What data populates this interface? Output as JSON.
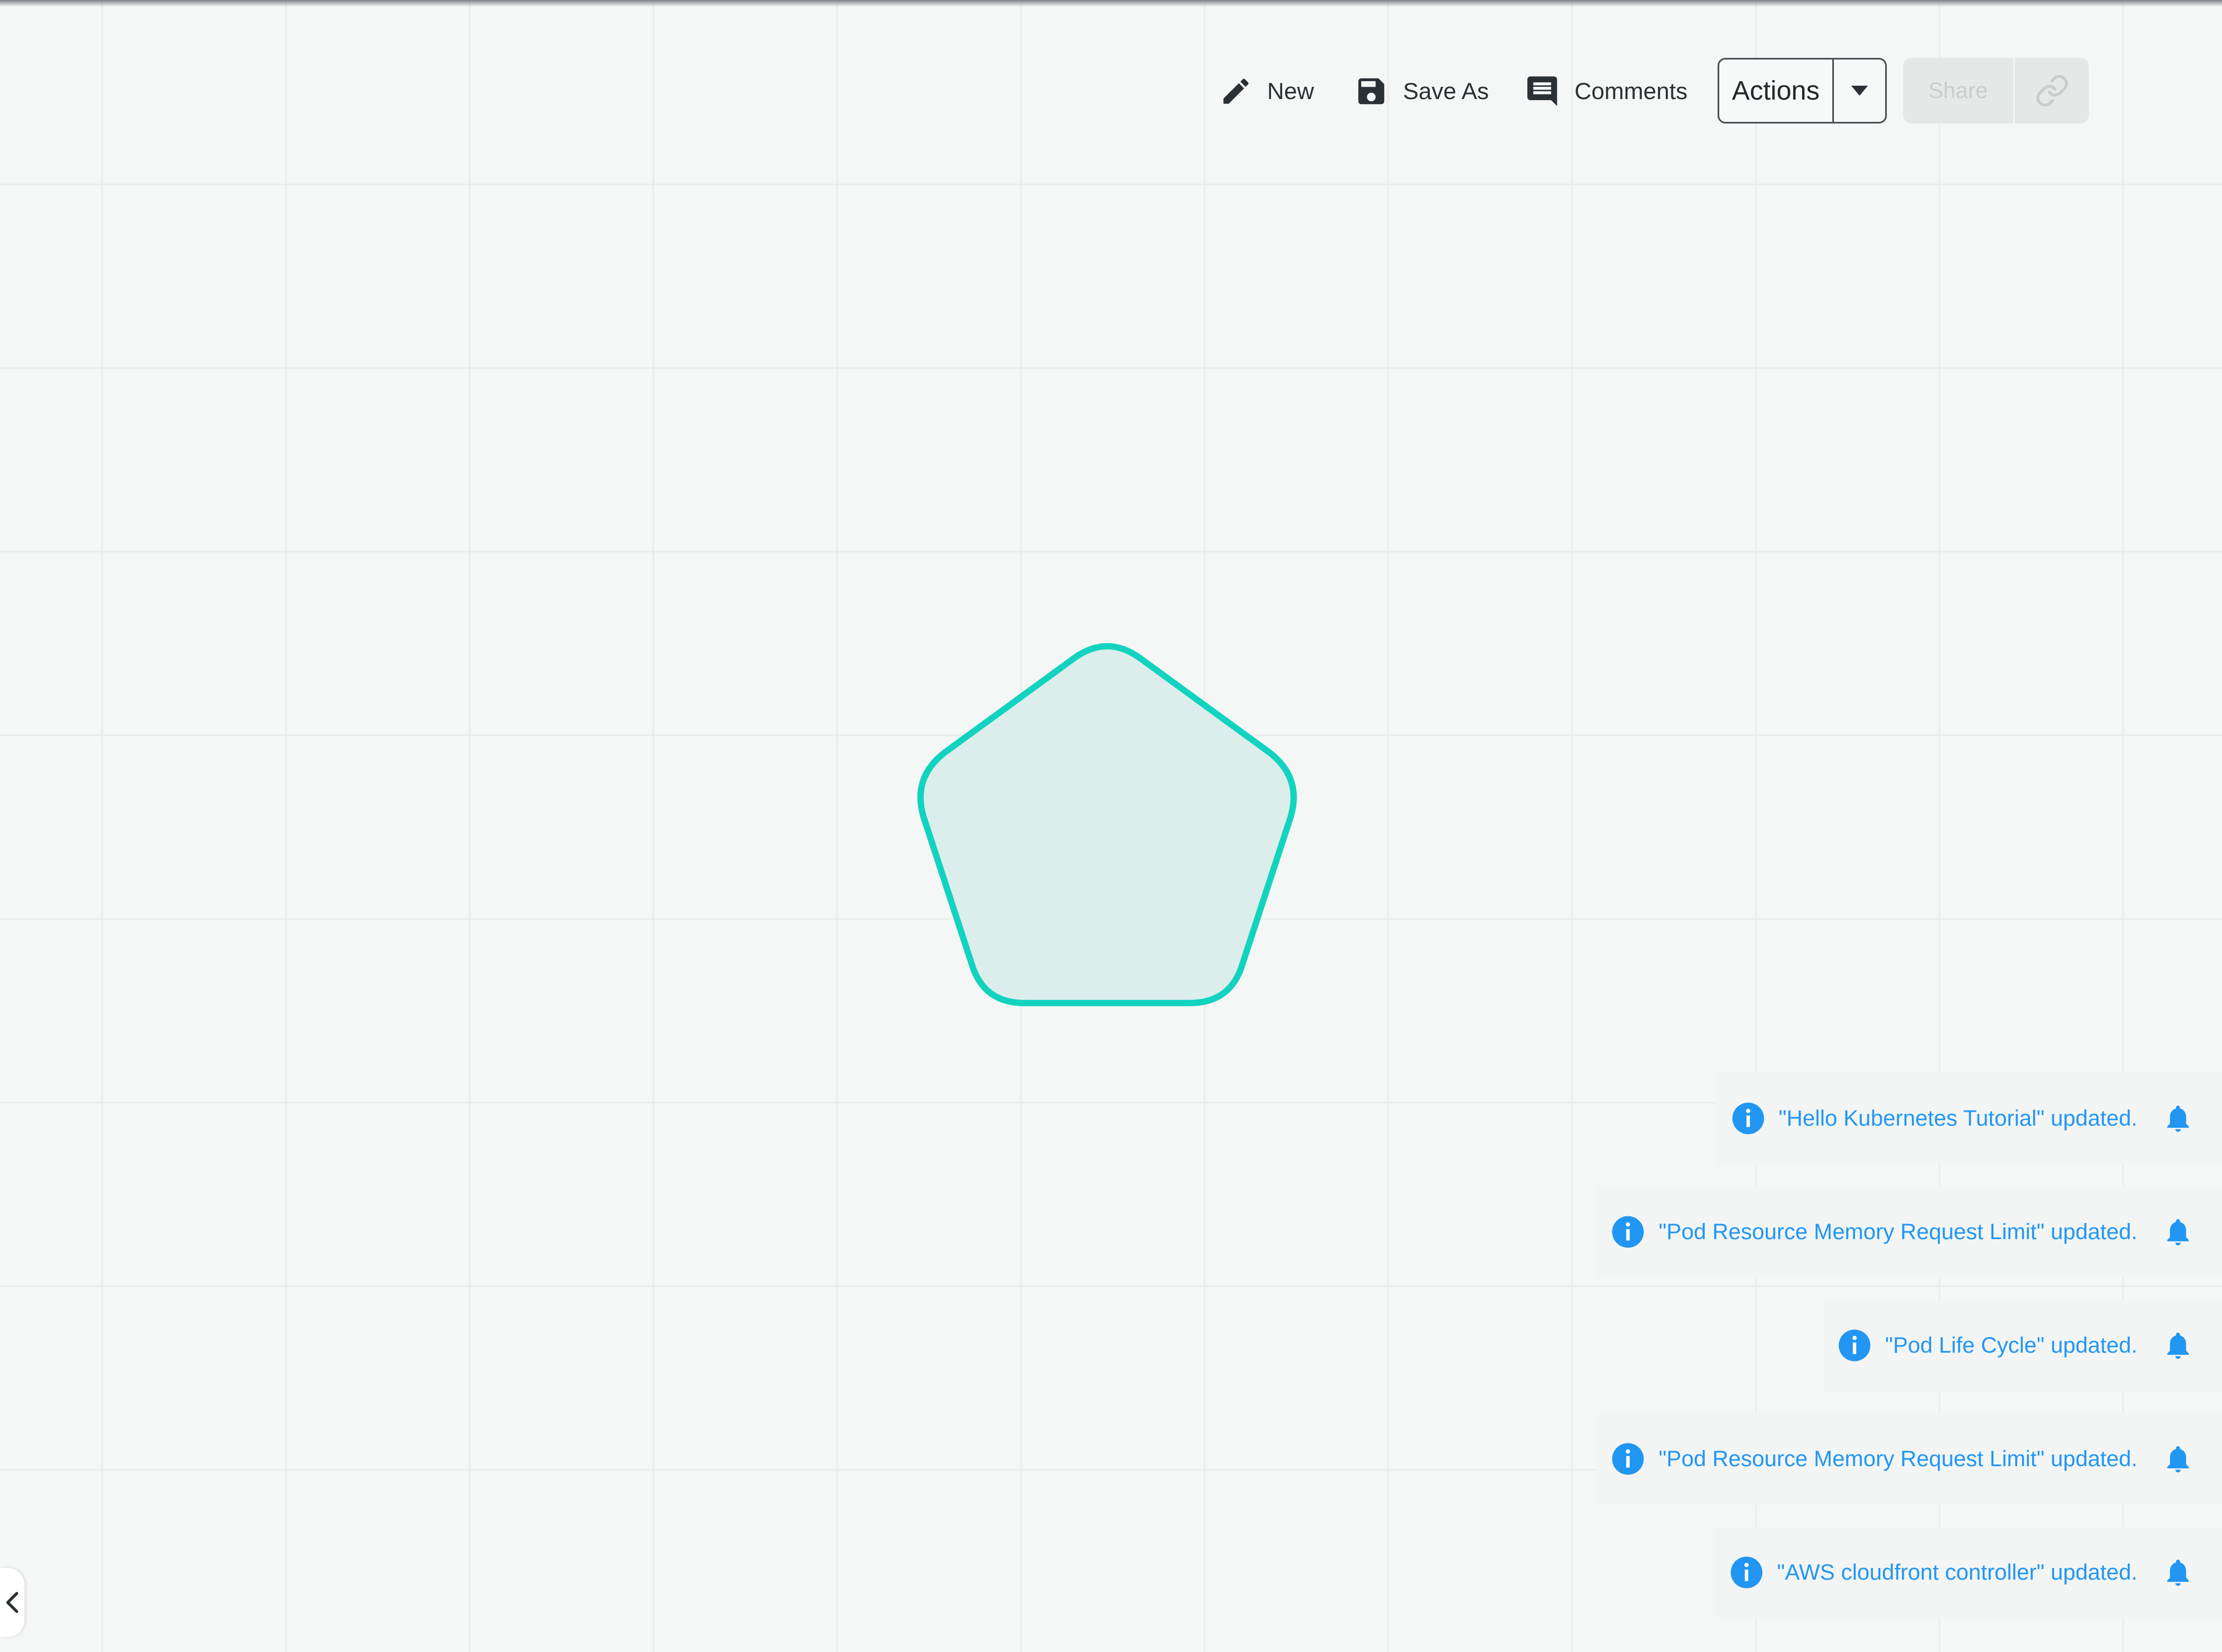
{
  "toolbar": {
    "new_label": "New",
    "save_as_label": "Save As",
    "comments_label": "Comments",
    "actions_label": "Actions",
    "share_label": "Share",
    "icons": {
      "new": "pencil-icon",
      "save_as": "floppy-disk-icon",
      "comments": "comment-icon",
      "actions_menu": "caret-down-icon",
      "copy_link": "link-icon"
    }
  },
  "canvas": {
    "shape_type": "pentagon",
    "shape_stroke_color": "#12d3bf",
    "shape_fill_color": "#dceeeb"
  },
  "notifications": [
    {
      "message": "\"Hello Kubernetes Tutorial\" updated."
    },
    {
      "message": "\"Pod Resource Memory Request Limit\" updated."
    },
    {
      "message": "\"Pod Life Cycle\" updated."
    },
    {
      "message": "\"Pod Resource Memory Request Limit\" updated."
    },
    {
      "message": "\"AWS cloudfront controller\" updated."
    }
  ],
  "colors": {
    "notification_text": "#2196f3",
    "background": "#f5f7f6",
    "accent": "#12d3bf"
  }
}
